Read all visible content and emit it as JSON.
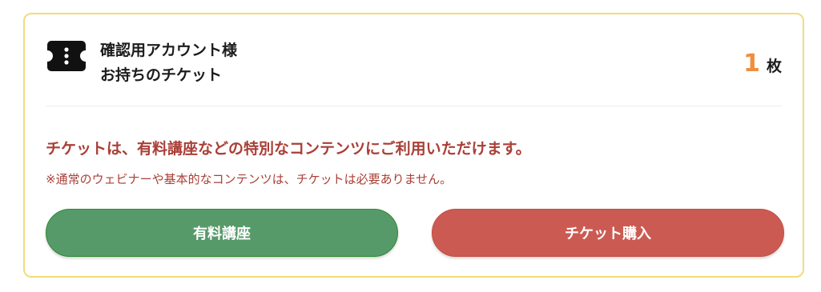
{
  "ticket_card": {
    "icon": "ticket-icon",
    "owner_line1": "確認用アカウント様",
    "owner_line2": "お持ちのチケット",
    "count": "1",
    "count_unit": "枚",
    "notice": "チケットは、有料講座などの特別なコンテンツにご利用いただけます。",
    "note": "※通常のウェビナーや基本的なコンテンツは、チケットは必要ありません。",
    "buttons": {
      "paid_courses_label": "有料講座",
      "buy_ticket_label": "チケット購入"
    }
  },
  "colors": {
    "card_border": "#f1dc7c",
    "count_accent": "#ef8f3e",
    "notice_text": "#a93f37",
    "paid_button": "#579a69",
    "buy_button": "#cb5b52"
  }
}
